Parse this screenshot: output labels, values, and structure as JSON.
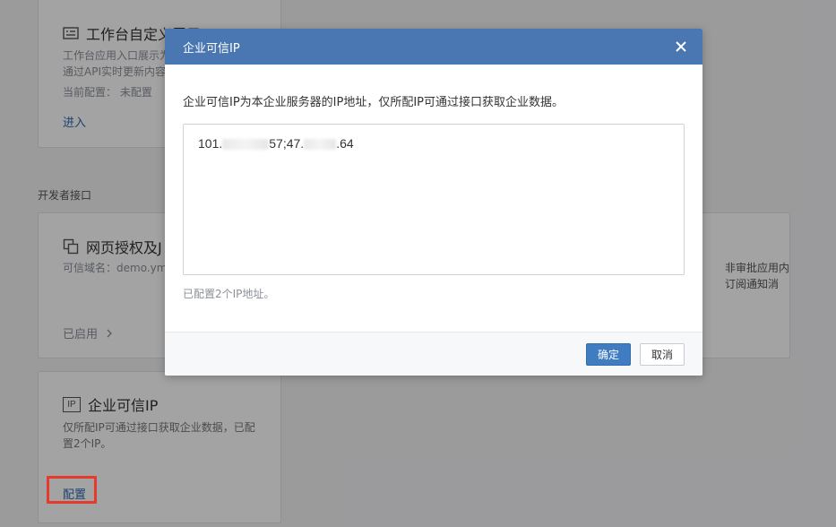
{
  "background": {
    "workbench_card": {
      "title": "工作台自定义展示",
      "desc_line1": "工作台应用入口展示为",
      "desc_line2": "通过API实时更新内容",
      "current_config": "当前配置：  未配置",
      "link": "进入"
    },
    "section_label": "开发者接口",
    "oauth_card": {
      "title": "网页授权及J",
      "domain": "可信域名：demo.ym",
      "status": "已启用"
    },
    "right_card": {
      "line1": "非审批应用内",
      "line2": "订阅通知消"
    },
    "ip_card": {
      "icon_text": "IP",
      "title": "企业可信IP",
      "desc_line1": "仅所配IP可通过接口获取企业数据，已配",
      "desc_line2": "置2个IP。",
      "config_link": "配置"
    }
  },
  "dialog": {
    "title": "企业可信IP",
    "description": "企业可信IP为本企业服务器的IP地址，仅所配IP可通过接口获取企业数据。",
    "ip_part1": "101.",
    "ip_part2": "57;47.",
    "ip_part3": ".64",
    "ip_count": "已配置2个IP地址。",
    "confirm_label": "确定",
    "cancel_label": "取消"
  },
  "colors": {
    "header": "#4a77b1",
    "primary_button": "#3f7cc1",
    "highlight": "#e53a2c",
    "link": "#2d6ab0"
  }
}
